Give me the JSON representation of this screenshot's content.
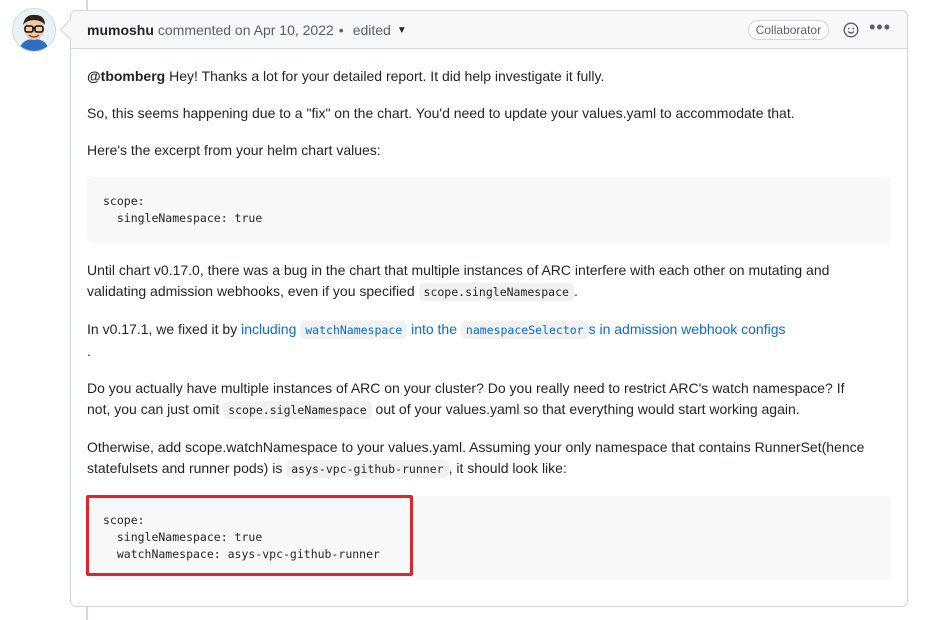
{
  "header": {
    "author": "mumoshu",
    "action": "commented on Apr 10, 2022",
    "separator": "•",
    "edited": "edited",
    "badge": "Collaborator"
  },
  "body": {
    "p1_mention": "@tbomberg",
    "p1_rest": " Hey! Thanks a lot for your detailed report. It did help investigate it fully.",
    "p2": "So, this seems happening due to a \"fix\" on the chart. You'd need to update your values.yaml to accommodate that.",
    "p3": "Here's the excerpt from your helm chart values:",
    "code1": "scope:\n  singleNamespace: true",
    "p4_line1": "Until chart v0.17.0, there was a bug in the chart that multiple instances of ARC interfere with each other on mutating and",
    "p4_line2_start": "validating admission webhooks, even if you specified ",
    "p4_code": "scope.singleNamespace",
    "p4_end": ".",
    "p5_start": "In v0.17.1, we fixed it by ",
    "p5_link1": "including ",
    "p5_code1": "watchNamespace",
    "p5_link2": " into the ",
    "p5_code2": "namespaceSelector",
    "p5_link3": "s in admission webhook configs",
    "p5_end": ".",
    "p6_line1": "Do you actually have multiple instances of ARC on your cluster? Do you really need to restrict ARC's watch namespace? If",
    "p6_line2_start": "not, you can just omit ",
    "p6_code": "scope.sigleNamespace",
    "p6_line2_end": " out of your values.yaml so that everything would start working again.",
    "p7_line1": "Otherwise, add scope.watchNamespace to your values.yaml. Assuming your only namespace that contains RunnerSet(hence",
    "p7_line2_start": "statefulsets and runner pods) is ",
    "p7_code": "asys-vpc-github-runner",
    "p7_line2_end": ", it should look like:",
    "code2": "scope:\n  singleNamespace: true\n  watchNamespace: asys-vpc-github-runner"
  },
  "colors": {
    "link": "#0969da",
    "highlight_box": "#e0242c",
    "code_bg": "#f6f8fa"
  }
}
